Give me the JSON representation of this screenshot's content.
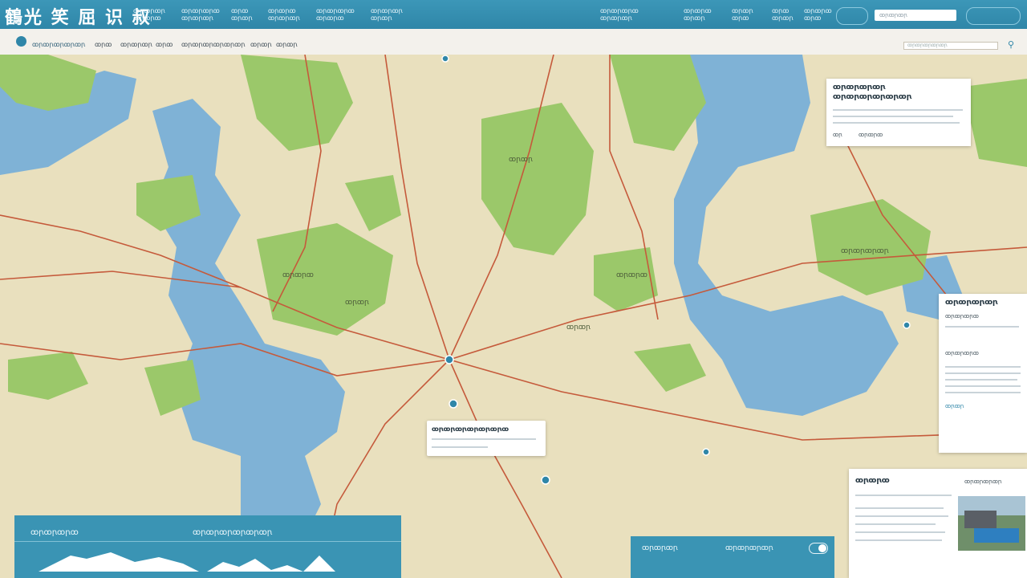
{
  "header": {
    "logo": "鶴光 笑 屈 识 叔",
    "nav": [
      {
        "line1": "ꝏꞃꝏꞃꝏꞃ",
        "line2": "ꝏꞃꝏꞃꝏ"
      },
      {
        "line1": "ꝏꞃꝏꞃꝏꞃꝏ",
        "line2": "ꝏꞃꝏꞃꝏꞃ"
      },
      {
        "line1": "ꝏꞃꝏ",
        "line2": "ꝏꞃꝏꞃ"
      },
      {
        "line1": "ꝏꞃꝏꞃꝏ",
        "line2": "ꝏꞃꝏꞃꝏꞃ"
      },
      {
        "line1": "ꝏꞃꝏꞃꝏꞃꝏ",
        "line2": "ꝏꞃꝏꞃꝏ"
      },
      {
        "line1": "ꝏꞃꝏꞃꝏꞃ",
        "line2": "ꝏꞃꝏꞃ"
      },
      {
        "line1": "ꝏꞃꝏꞃꝏꞃꝏ",
        "line2": "ꝏꞃꝏꞃꝏꞃ"
      },
      {
        "line1": "ꝏꞃꝏꞃꝏ",
        "line2": "ꝏꞃꝏꞃ"
      },
      {
        "line1": "ꝏꞃꝏꞃ",
        "line2": "ꝏꞃꝏ"
      },
      {
        "line1": "ꝏꞃꝏ",
        "line2": "ꝏꞃꝏꞃ"
      },
      {
        "line1": "ꝏꞃꝏꞃꝏ",
        "line2": "ꝏꞃꝏ"
      }
    ],
    "search_placeholder": "ꝏꞃꝏꞃꝏꞃ"
  },
  "subheader": {
    "brand": "ꝏꞃꝏꞃꝏꞃꝏꞃꝏꞃ",
    "nav": [
      "ꝏꞃꝏ",
      "ꝏꞃꝏꞃꝏꞃ",
      "ꝏꞃꝏ",
      "ꝏꞃꝏꞃꝏꞃꝏꞃꝏꞃꝏꞃ",
      "ꝏꞃꝏꞃ",
      "ꝏꞃꝏꞃ"
    ],
    "search_placeholder": "ꝏꞃꝏꞃꝏꞃꝏꞃꝏꞃ"
  },
  "map_labels": [
    {
      "text": "ꝏꞃꝏꞃ"
    },
    {
      "text": "ꝏꞃꝏꞃꝏ"
    },
    {
      "text": "ꝏꞃꝏꞃ"
    },
    {
      "text": "ꝏꞃꝏꞃꝏ"
    },
    {
      "text": "ꝏꞃꝏꞃꝏꞃꝏꞃ"
    },
    {
      "text": "ꝏꞃꝏꞃ"
    }
  ],
  "card_top_right": {
    "title1": "ꝏꞃꝏꞃꝏꞃꝏꞃ",
    "title2": "ꝏꞃꝏꞃꝏꞃꝏꞃꝏꞃꝏꞃ",
    "action1": "ꝏꞃ",
    "action2": "ꝏꞃꝏꞃꝏ"
  },
  "card_right_mid": {
    "title": "ꝏꞃꝏꞃꝏꞃꝏꞃ",
    "sub1": "ꝏꞃꝏꞃꝏꞃꝏ",
    "sub2": "ꝏꞃꝏꞃꝏꞃꝏ",
    "link": "ꝏꞃꝏꞃ"
  },
  "popup_center": {
    "title": "ꝏꞃꝏꞃꝏꞃꝏꞃꝏꞃꝏꞃꝏ"
  },
  "card_bottom_right": {
    "title": "ꝏꞃꝏꞃꝏ",
    "right_label": "ꝏꞃꝏꞃꝏꞃꝏꞃ"
  },
  "panel_bottom_left": {
    "left": "ꝏꞃꝏꞃꝏꞃꝏ",
    "right": "ꝏꞃꝏꞃꝏꞃꝏꞃꝏꞃꝏꞃ"
  },
  "panel_bottom_mid": {
    "left": "ꝏꞃꝏꞃꝏꞃ",
    "right": "ꝏꞃꝏꞃꝏꞃꝏꞃ"
  }
}
